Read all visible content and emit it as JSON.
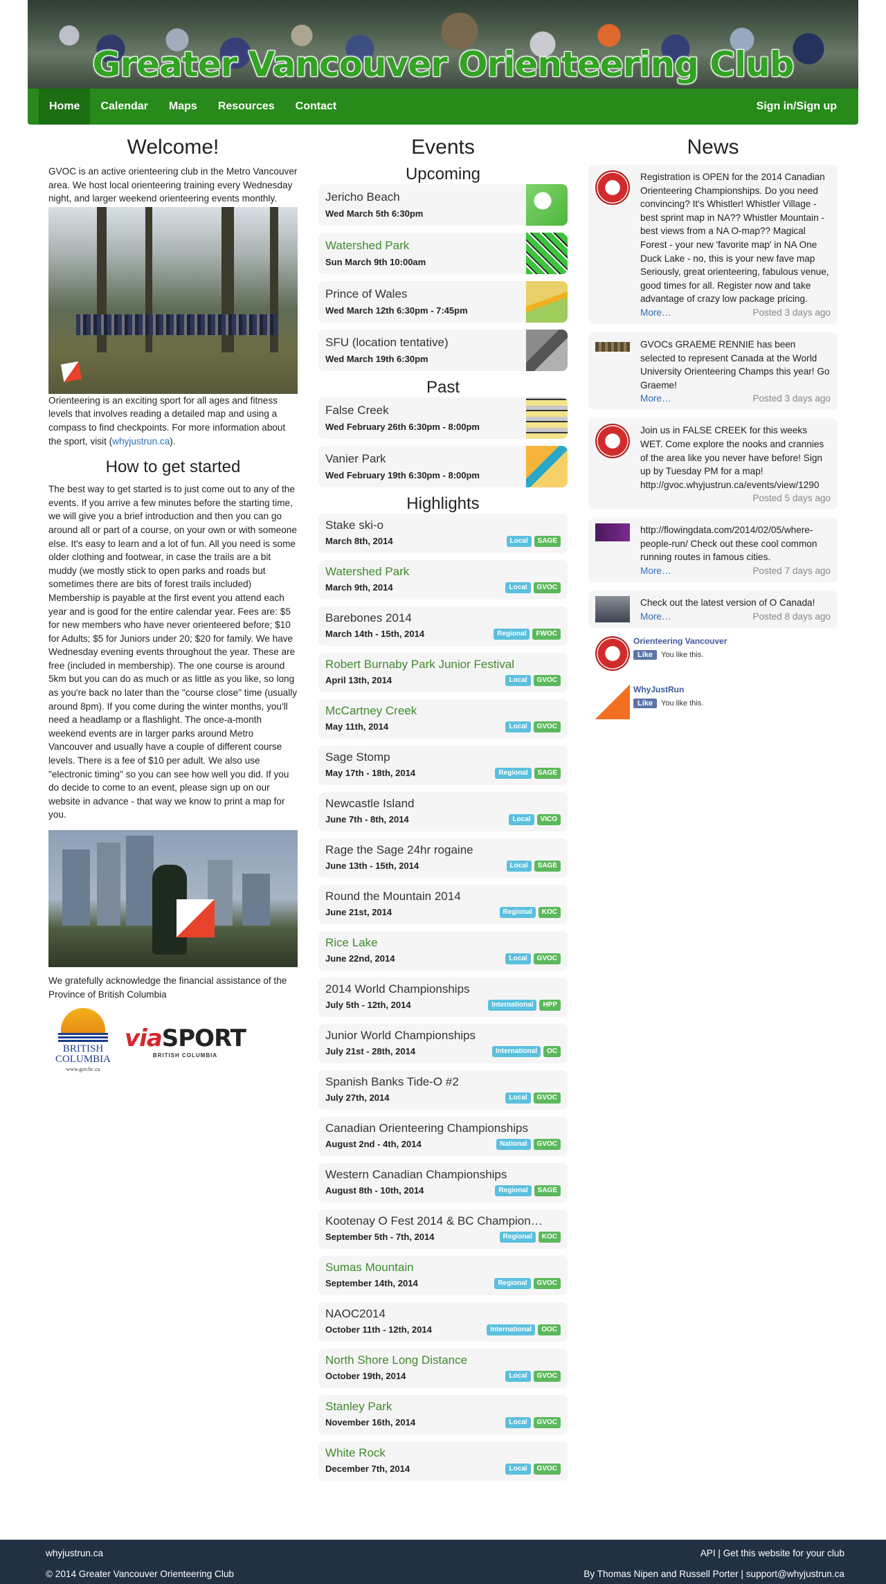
{
  "banner": {
    "title": "Greater Vancouver Orienteering Club"
  },
  "nav": {
    "items": [
      "Home",
      "Calendar",
      "Maps",
      "Resources",
      "Contact"
    ],
    "signin": "Sign in/Sign up"
  },
  "welcome": {
    "title": "Welcome!",
    "intro": "GVOC is an active orienteering club in the Metro Vancouver area. We host local orienteering training every Wednesday night, and larger weekend orienteering events monthly.",
    "about_prefix": "Orienteering is an exciting sport for all ages and fitness levels that involves reading a detailed map and using a compass to find checkpoints. For more information about the sport, visit (",
    "about_link": "whyjustrun.ca",
    "about_suffix": ").",
    "started_title": "How to get started",
    "started_text": "The best way to get started is to just come out to any of the events. If you arrive a few minutes before the starting time, we will give you a brief introduction and then you can go around all or part of a course, on your own or with someone else. It's easy to learn and a lot of fun. All you need is some older clothing and footwear, in case the trails are a bit muddy (we mostly stick to open parks and roads but sometimes there are bits of forest trails included) Membership is payable at the first event you attend each year and is good for the entire calendar year. Fees are: $5 for new members who have never orienteered before; $10 for Adults; $5 for Juniors under 20; $20 for family. We have Wednesday evening events throughout the year. These are free (included in membership). The one course is around 5km but you can do as much or as little as you like, so long as you're back no later than the \"course close\" time (usually around 8pm). If you come during the winter months, you'll need a headlamp or a flashlight. The once-a-month weekend events are in larger parks around Metro Vancouver and usually have a couple of different course levels. There is a fee of $10 per adult. We also use \"electronic timing\" so you can see how well you did. If you do decide to come to an event, please sign up on our website in advance - that way we know to print a map for you.",
    "acknowledge": "We gratefully acknowledge the financial assistance of the Province of British Columbia",
    "bc_logo_text": "BRITISH COLUMBIA",
    "bc_logo_url": "www.gov.bc.ca",
    "viasport_via": "via",
    "viasport_sport": "SPORT",
    "viasport_sub": "BRITISH COLUMBIA"
  },
  "events": {
    "title": "Events",
    "upcoming_title": "Upcoming",
    "upcoming": [
      {
        "name": "Jericho Beach",
        "date": "Wed March 5th 6:30pm",
        "green": false
      },
      {
        "name": "Watershed Park",
        "date": "Sun March 9th 10:00am",
        "green": true
      },
      {
        "name": "Prince of Wales",
        "date": "Wed March 12th 6:30pm - 7:45pm",
        "green": false
      },
      {
        "name": "SFU (location tentative)",
        "date": "Wed March 19th 6:30pm",
        "green": false
      }
    ],
    "past_title": "Past",
    "past": [
      {
        "name": "False Creek",
        "date": "Wed February 26th 6:30pm - 8:00pm",
        "green": false
      },
      {
        "name": "Vanier Park",
        "date": "Wed February 19th 6:30pm - 8:00pm",
        "green": false
      }
    ],
    "highlights_title": "Highlights",
    "highlights": [
      {
        "name": "Stake ski-o",
        "date": "March 8th, 2014",
        "level": "Local",
        "club": "SAGE",
        "green": false
      },
      {
        "name": "Watershed Park",
        "date": "March 9th, 2014",
        "level": "Local",
        "club": "GVOC",
        "green": true
      },
      {
        "name": "Barebones 2014",
        "date": "March 14th - 15th, 2014",
        "level": "Regional",
        "club": "FWOC",
        "green": false
      },
      {
        "name": "Robert Burnaby Park Junior Festival",
        "date": "April 13th, 2014",
        "level": "Local",
        "club": "GVOC",
        "green": true
      },
      {
        "name": "McCartney Creek",
        "date": "May 11th, 2014",
        "level": "Local",
        "club": "GVOC",
        "green": true
      },
      {
        "name": "Sage Stomp",
        "date": "May 17th - 18th, 2014",
        "level": "Regional",
        "club": "SAGE",
        "green": false
      },
      {
        "name": "Newcastle Island",
        "date": "June 7th - 8th, 2014",
        "level": "Local",
        "club": "VICO",
        "green": false
      },
      {
        "name": "Rage the Sage 24hr rogaine",
        "date": "June 13th - 15th, 2014",
        "level": "Local",
        "club": "SAGE",
        "green": false
      },
      {
        "name": "Round the Mountain 2014",
        "date": "June 21st, 2014",
        "level": "Regional",
        "club": "KOC",
        "green": false
      },
      {
        "name": "Rice Lake",
        "date": "June 22nd, 2014",
        "level": "Local",
        "club": "GVOC",
        "green": true
      },
      {
        "name": "2014 World Championships",
        "date": "July 5th - 12th, 2014",
        "level": "International",
        "club": "HPP",
        "green": false
      },
      {
        "name": "Junior World Championships",
        "date": "July 21st - 28th, 2014",
        "level": "International",
        "club": "OC",
        "green": false
      },
      {
        "name": "Spanish Banks Tide-O #2",
        "date": "July 27th, 2014",
        "level": "Local",
        "club": "GVOC",
        "green": false
      },
      {
        "name": "Canadian Orienteering Championships",
        "date": "August 2nd - 4th, 2014",
        "level": "National",
        "club": "GVOC",
        "green": false
      },
      {
        "name": "Western Canadian Championships",
        "date": "August 8th - 10th, 2014",
        "level": "Regional",
        "club": "SAGE",
        "green": false
      },
      {
        "name": "Kootenay O Fest 2014 & BC Champion…",
        "date": "September 5th - 7th, 2014",
        "level": "Regional",
        "club": "KOC",
        "green": false
      },
      {
        "name": "Sumas Mountain",
        "date": "September 14th, 2014",
        "level": "Regional",
        "club": "GVOC",
        "green": true
      },
      {
        "name": "NAOC2014",
        "date": "October 11th - 12th, 2014",
        "level": "International",
        "club": "OOC",
        "green": false
      },
      {
        "name": "North Shore Long Distance",
        "date": "October 19th, 2014",
        "level": "Local",
        "club": "GVOC",
        "green": true
      },
      {
        "name": "Stanley Park",
        "date": "November 16th, 2014",
        "level": "Local",
        "club": "GVOC",
        "green": true
      },
      {
        "name": "White Rock",
        "date": "December 7th, 2014",
        "level": "Local",
        "club": "GVOC",
        "green": true
      }
    ]
  },
  "news": {
    "title": "News",
    "items": [
      {
        "text": "Registration is OPEN for the 2014 Canadian Orienteering Championships. Do you need convincing? It's Whistler! Whistler Village - best sprint map in NA?? Whistler Mountain - best views from a NA O-map?? Magical Forest - your new 'favorite map' in NA One Duck Lake - no, this is your new fave map Seriously, great orienteering, fabulous venue, good times for all. Register now and take advantage of crazy low package pricing.",
        "more": "More…",
        "posted": "Posted 3 days ago"
      },
      {
        "text": "GVOCs GRAEME RENNIE has been selected to represent Canada at the World University Orienteering Champs this year! Go Graeme!",
        "more": "More…",
        "posted": "Posted 3 days ago"
      },
      {
        "text": "Join us in FALSE CREEK for this weeks WET. Come explore the nooks and crannies of the area like you never have before! Sign up by Tuesday PM for a map! http://gvoc.whyjustrun.ca/events/view/1290",
        "more": "",
        "posted": "Posted 5 days ago"
      },
      {
        "text": "http://flowingdata.com/2014/02/05/where-people-run/ Check out these cool common running routes in famous cities.",
        "more": "More…",
        "posted": "Posted 7 days ago"
      },
      {
        "text": "Check out the latest version of O Canada!",
        "more": "More…",
        "posted": "Posted 8 days ago"
      }
    ],
    "facebook": [
      {
        "name": "Orienteering Vancouver",
        "like": "Like",
        "you": "You like this."
      },
      {
        "name": "WhyJustRun",
        "like": "Like",
        "you": "You like this."
      }
    ]
  },
  "footer": {
    "left_top": "whyjustrun.ca",
    "left_bottom": "© 2014 Greater Vancouver Orienteering Club",
    "right_top": "API | Get this website for your club",
    "right_bottom": "By Thomas Nipen and Russell Porter | support@whyjustrun.ca"
  },
  "colors": {
    "brand_green": "#278a1a",
    "footer_bg": "#223044",
    "tag_level": "#5bc0de",
    "tag_club": "#5cb85c",
    "link": "#2a6ebb"
  }
}
